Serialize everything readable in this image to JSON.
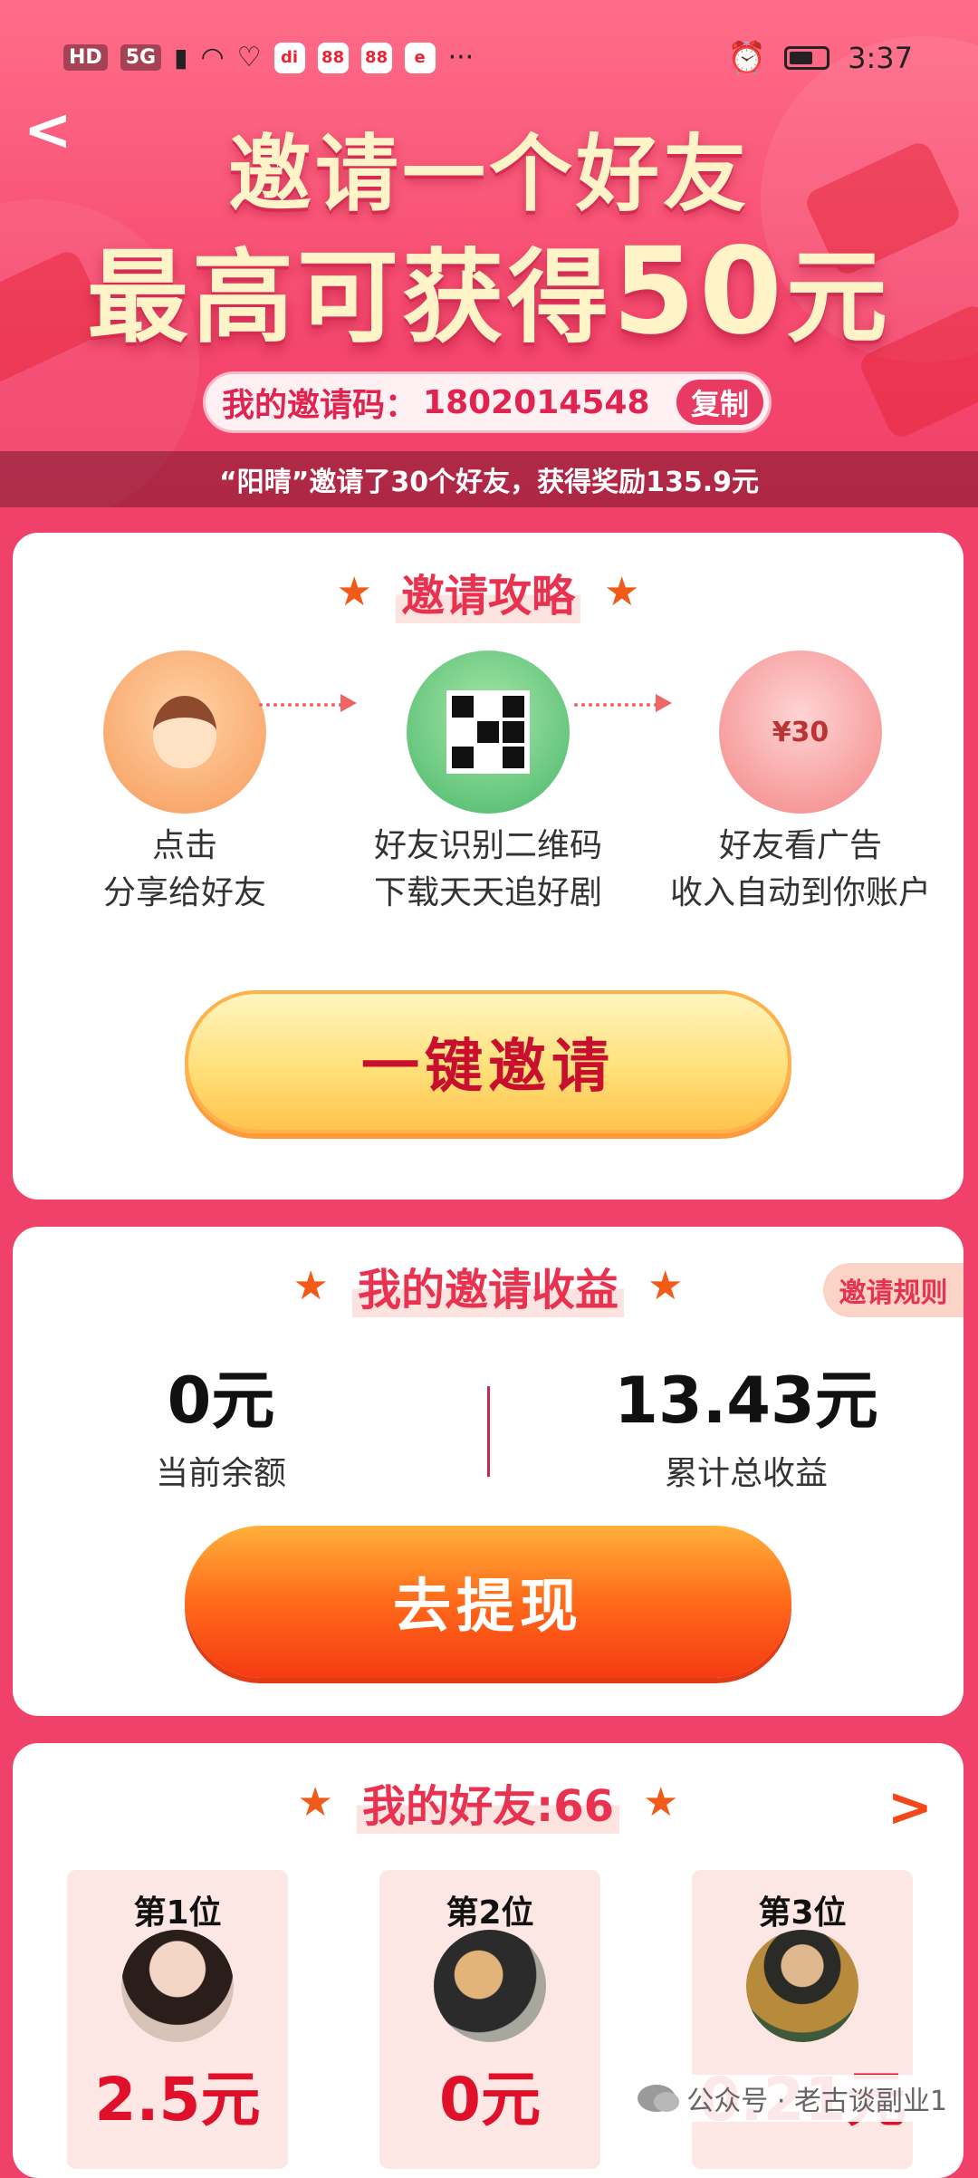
{
  "status_bar": {
    "left_chips": [
      "HD",
      "5G"
    ],
    "left_apps": [
      "di",
      "88",
      "88",
      "e"
    ],
    "more": "···",
    "time": "3:37"
  },
  "hero": {
    "title_line1": "邀请一个好友",
    "title_line2_prefix": "最高可获得",
    "title_line2_amount": "50",
    "title_line2_suffix": "元",
    "invite_code_label": "我的邀请码：",
    "invite_code": "1802014548",
    "copy_label": "复制",
    "ticker": "“阳晴”邀请了30个好友，获得奖励135.9元"
  },
  "strategy": {
    "title": "邀请攻略",
    "steps": [
      {
        "line1": "点击",
        "line2": "分享给好友"
      },
      {
        "line1": "好友识别二维码",
        "line2": "下载天天追好剧"
      },
      {
        "line1": "好友看广告",
        "line2": "收入自动到你账户"
      }
    ],
    "money_tag": "¥30",
    "invite_button": "一键邀请"
  },
  "earnings": {
    "title": "我的邀请收益",
    "rules": "邀请规则",
    "balance_value": "0元",
    "balance_label": "当前余额",
    "total_value": "13.43元",
    "total_label": "累计总收益",
    "withdraw_button": "去提现"
  },
  "friends": {
    "title": "我的好友:66",
    "ranks": [
      {
        "rank": "第1位",
        "amount": "2.5元"
      },
      {
        "rank": "第2位",
        "amount": "0元"
      },
      {
        "rank": "第3位",
        "amount": "0.21元"
      }
    ]
  },
  "watermark": "公众号 · 老古谈副业1",
  "colors": {
    "brand": "#f0416a",
    "accent_red": "#e8324f",
    "button_orange": "#ff6a1a",
    "button_yellow": "#ffe07a"
  }
}
